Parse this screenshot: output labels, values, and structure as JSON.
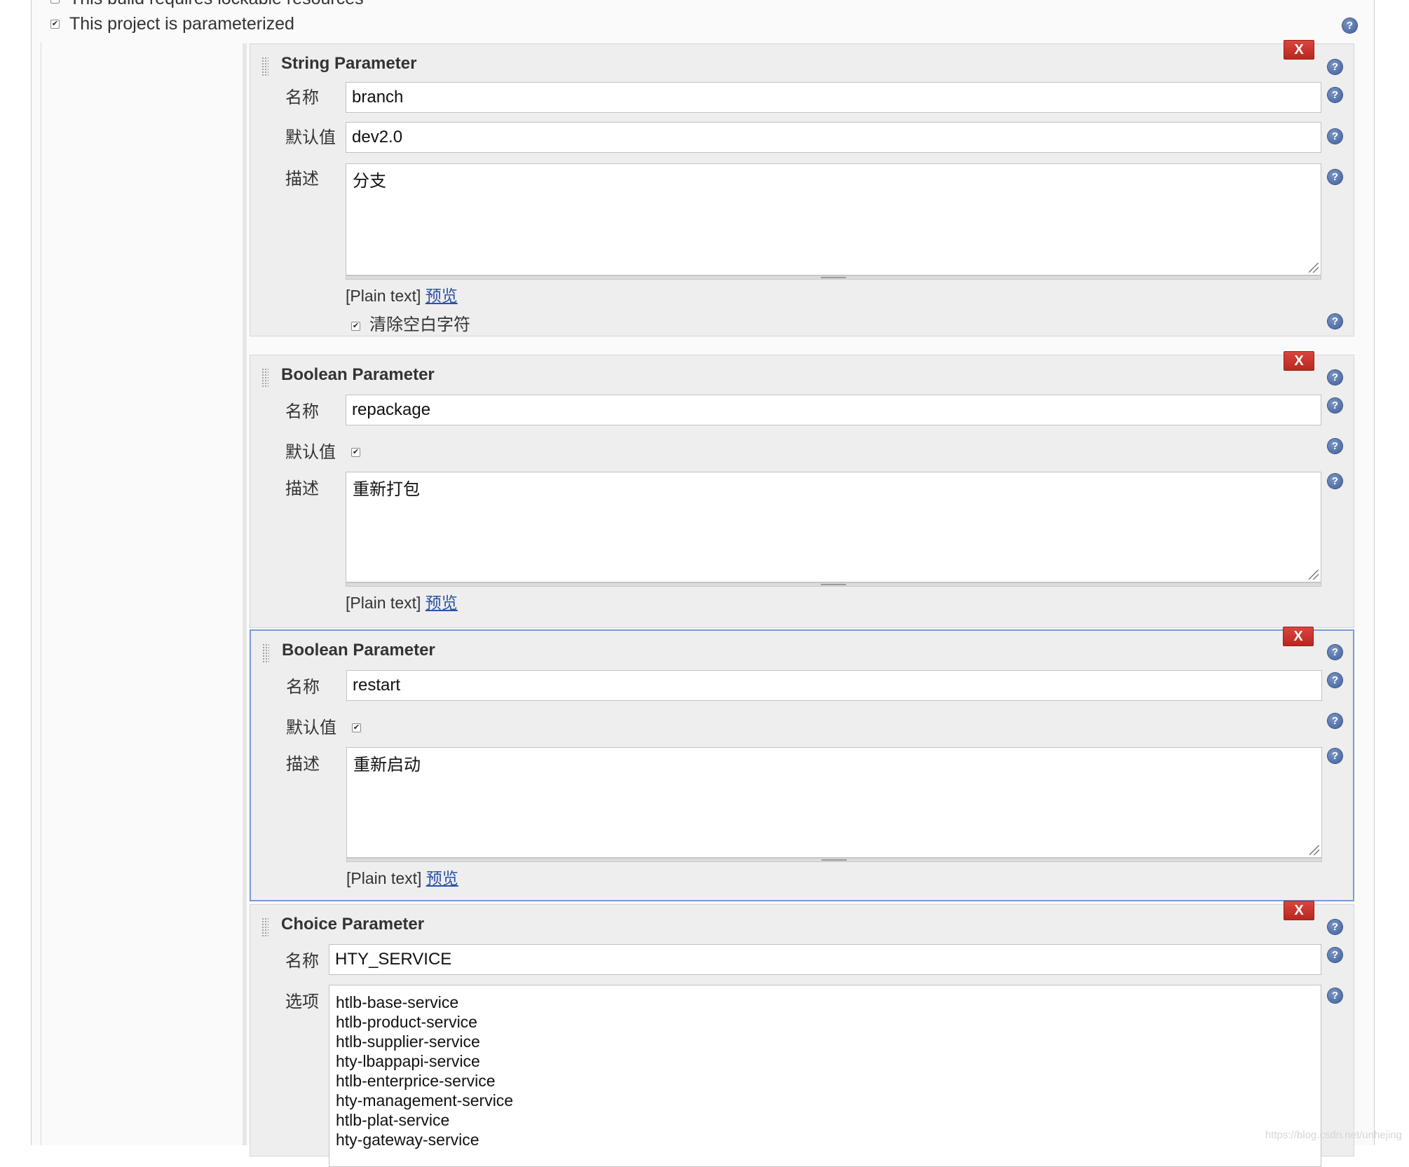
{
  "top_options": {
    "lockable_label": "This build requires lockable resources",
    "parameterized_label": "This project is parameterized",
    "parameterized_checked": true
  },
  "labels": {
    "name": "名称",
    "default_value": "默认值",
    "description": "描述",
    "choices": "选项",
    "plain_text": "[Plain text]",
    "preview": "预览",
    "delete": "X",
    "help": "?",
    "trim": "清除空白字符"
  },
  "params": [
    {
      "type": "String Parameter",
      "name": "branch",
      "default": "dev2.0",
      "description": "分支",
      "trim_checked": true
    },
    {
      "type": "Boolean Parameter",
      "name": "repackage",
      "default_checked": true,
      "description": "重新打包"
    },
    {
      "type": "Boolean Parameter",
      "name": "restart",
      "default_checked": true,
      "description": "重新启动"
    },
    {
      "type": "Choice Parameter",
      "name": "HTY_SERVICE",
      "choices": [
        "htlb-base-service",
        "htlb-product-service",
        "htlb-supplier-service",
        "hty-lbappapi-service",
        "htlb-enterprice-service",
        "hty-management-service",
        "htlb-plat-service",
        "hty-gateway-service"
      ]
    }
  ],
  "watermark": "https://blog.csdn.net/unhejing"
}
